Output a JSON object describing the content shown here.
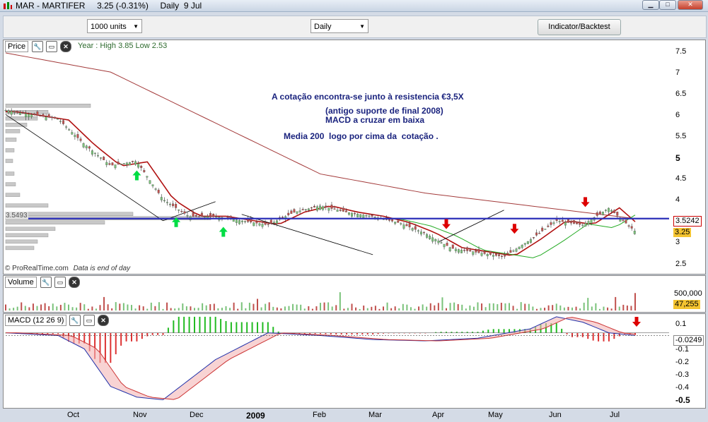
{
  "window": {
    "title": "MAR - MARTIFER     3.25 (-0.31%)     Daily  9 Jul",
    "minimize": "▁",
    "maximize": "□",
    "close": "✕"
  },
  "toolbar": {
    "units_select": "1000 units",
    "period_select": "Daily",
    "indicator_button": "Indicator/Backtest"
  },
  "price_panel": {
    "label": "Price",
    "year_info": "Year : High 3.85 Low 2.53",
    "copyright": "© ProRealTime.com",
    "data_note": "Data is end of day",
    "resistance_value": "3.5493",
    "resistance_badge": "3.5242",
    "last_price_badge": "3.25",
    "notes": [
      "A cotação encontra-se junto à resistencia €3,5X",
      "(antigo suporte de final 2008)",
      "MACD a cruzar em baixa",
      "Media 200  logo por cima da  cotação ."
    ]
  },
  "volume_panel": {
    "label": "Volume",
    "badge": "47,255"
  },
  "macd_panel": {
    "label": "MACD (12 26 9)",
    "badge": "-0.0249"
  },
  "colors": {
    "resistance": "#2b2fb8",
    "ma_long": "#a33a3a",
    "ma_short": "#b01010",
    "ma_green": "#22aa22",
    "macd_bull": "#22bb22",
    "macd_bear": "#dd3333",
    "arrow_up": "#00dd44",
    "arrow_down": "#dd0000",
    "text_note": "#1a237e"
  },
  "icons": [
    "wrench-icon",
    "window-icon",
    "close-icon",
    "arrow-up-icon",
    "arrow-down-icon"
  ],
  "chart_data": {
    "type": "candlestick",
    "title": "MAR - MARTIFER",
    "x_ticks": [
      "Oct",
      "Nov",
      "Dec",
      "2009",
      "Feb",
      "Mar",
      "Apr",
      "May",
      "Jun",
      "Jul"
    ],
    "price_axis": {
      "ticks": [
        "7.5",
        "7",
        "6.5",
        "6",
        "5.5",
        "5",
        "4.5",
        "4",
        "3.5",
        "3",
        "2.5"
      ],
      "ylim": [
        2.3,
        7.6
      ]
    },
    "volume_axis": {
      "ticks": [
        "500,000"
      ]
    },
    "macd_axis": {
      "ticks": [
        "0.1",
        "-0.1",
        "-0.2",
        "-0.3",
        "-0.4",
        "-0.5"
      ],
      "ylim": [
        -0.55,
        0.13
      ]
    },
    "resistance_level": 3.55,
    "price_series": {
      "name": "Close",
      "x": [
        0,
        10,
        20,
        30,
        40,
        50,
        60,
        70,
        80,
        90,
        100,
        110,
        120,
        130,
        140,
        150,
        160,
        170,
        180,
        190,
        200,
        210,
        220,
        230,
        240
      ],
      "values": [
        6.1,
        6.0,
        5.9,
        5.3,
        4.8,
        4.9,
        4.0,
        3.6,
        3.6,
        3.5,
        3.4,
        3.7,
        3.85,
        3.7,
        3.6,
        3.45,
        3.2,
        2.85,
        2.75,
        2.65,
        3.05,
        3.5,
        3.4,
        3.8,
        3.25
      ]
    },
    "ma200_series": {
      "x": [
        0,
        40,
        80,
        120,
        160,
        200,
        240
      ],
      "values": [
        7.45,
        7.0,
        5.8,
        4.6,
        4.15,
        3.85,
        3.55
      ]
    },
    "arrows_up_dates": [
      50,
      65,
      83
    ],
    "arrows_down_dates": [
      168,
      194,
      221
    ],
    "macd_series": {
      "x": [
        0,
        20,
        30,
        40,
        50,
        60,
        80,
        100,
        120,
        140,
        160,
        180,
        200,
        210,
        220,
        230,
        240
      ],
      "values": [
        0.0,
        -0.02,
        -0.12,
        -0.4,
        -0.48,
        -0.5,
        -0.2,
        0.0,
        -0.02,
        -0.05,
        -0.06,
        -0.04,
        0.03,
        0.12,
        0.08,
        0.0,
        -0.02
      ]
    }
  }
}
